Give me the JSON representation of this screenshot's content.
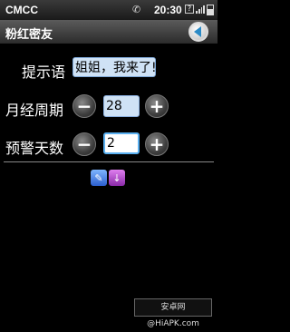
{
  "status_bar": {
    "carrier": "CMCC",
    "time": "20:30",
    "sig_badge": "?"
  },
  "title_bar": {
    "title": "粉红密友"
  },
  "form": {
    "message_label": "提示语",
    "message_value": "姐姐，我来了!",
    "period_label": "月经周期",
    "period_value": "28",
    "warn_label": "预警天数",
    "warn_value": "2",
    "minus": "−",
    "plus": "+"
  },
  "icons": {
    "app1": "✎",
    "app2": "↓"
  },
  "watermark": "安卓网@HiAPK.com"
}
